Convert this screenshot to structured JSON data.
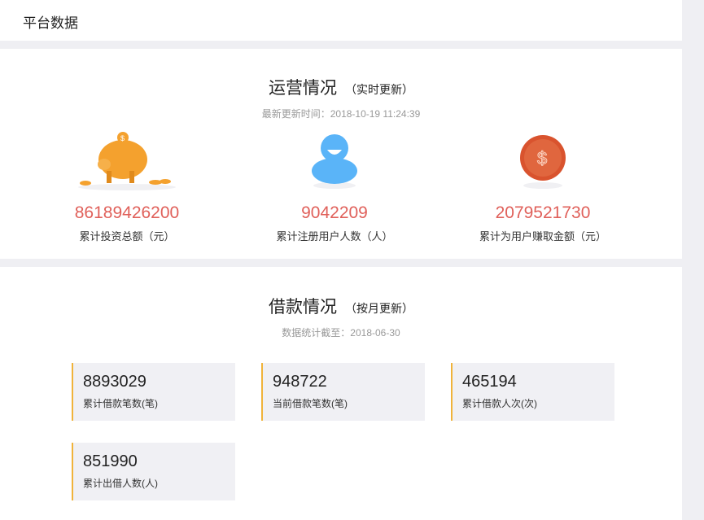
{
  "header": {
    "title": "平台数据"
  },
  "operations": {
    "title": "运营情况",
    "note": "（实时更新）",
    "updated": "最新更新时间：2018-10-19 11:24:39",
    "stats": [
      {
        "icon": "piggy-bank-icon",
        "value": "86189426200",
        "label": "累计投资总额（元）"
      },
      {
        "icon": "user-icon",
        "value": "9042209",
        "label": "累计注册用户人数（人）"
      },
      {
        "icon": "dollar-coin-icon",
        "value": "2079521730",
        "label": "累计为用户赚取金额（元）"
      }
    ]
  },
  "loans": {
    "title": "借款情况",
    "note": "（按月更新）",
    "updated": "数据统计截至：2018-06-30",
    "cards": [
      {
        "value": "8893029",
        "label": "累计借款笔数(笔)"
      },
      {
        "value": "948722",
        "label": "当前借款笔数(笔)"
      },
      {
        "value": "465194",
        "label": "累计借款人次(次)"
      },
      {
        "value": "851990",
        "label": "累计出借人数(人)"
      }
    ]
  },
  "colors": {
    "accent": "#e0605a",
    "card_border": "#f0b33a"
  }
}
